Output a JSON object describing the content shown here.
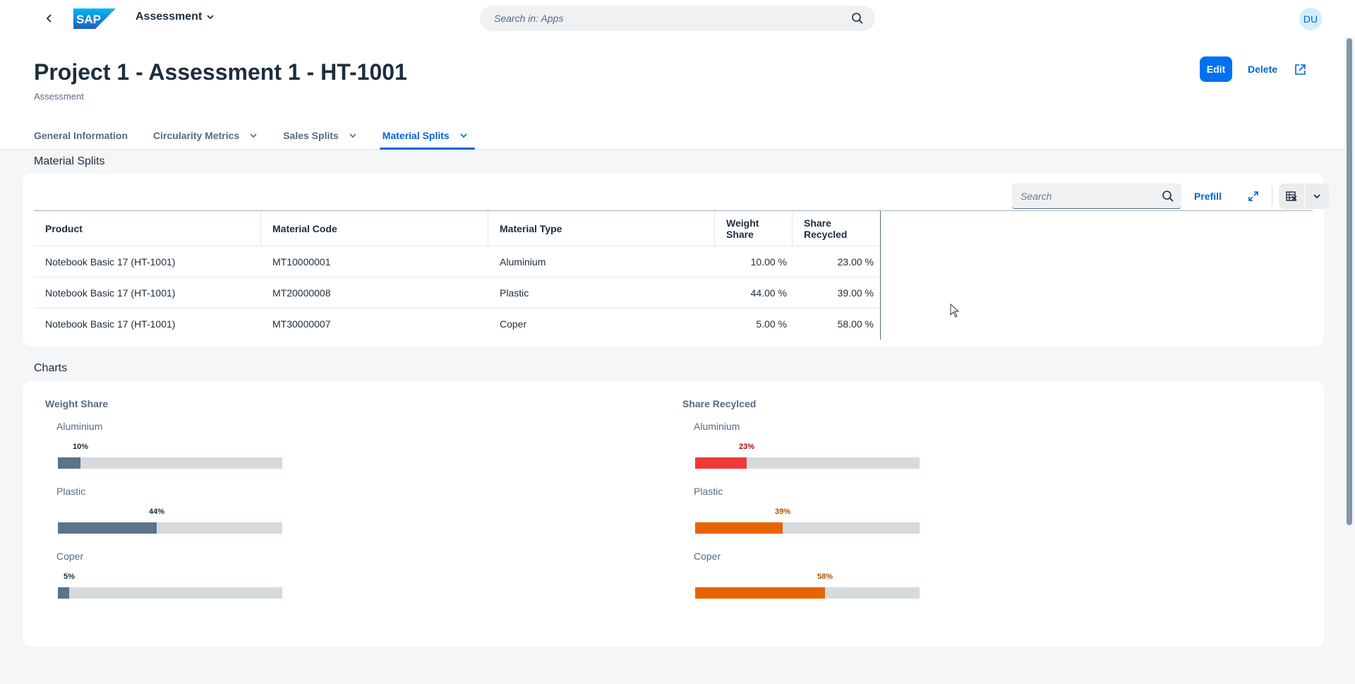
{
  "shell": {
    "app_title": "Assessment",
    "search_placeholder": "Search in: Apps",
    "avatar_initials": "DU",
    "logo_text": "SAP"
  },
  "header": {
    "title": "Project 1 - Assessment 1 - HT-1001",
    "subtitle": "Assessment",
    "edit_label": "Edit",
    "delete_label": "Delete"
  },
  "tabs": [
    {
      "label": "General Information",
      "has_menu": false,
      "active": false
    },
    {
      "label": "Circularity Metrics",
      "has_menu": true,
      "active": false
    },
    {
      "label": "Sales Splits",
      "has_menu": true,
      "active": false
    },
    {
      "label": "Material Splits",
      "has_menu": true,
      "active": true
    }
  ],
  "material_splits": {
    "section_title": "Material Splits",
    "search_placeholder": "Search",
    "prefill_label": "Prefill",
    "columns": [
      "Product",
      "Material Code",
      "Material Type",
      "Weight Share",
      "Share Recycled"
    ],
    "rows": [
      [
        "Notebook Basic 17 (HT-1001)",
        "MT10000001",
        "Aluminium",
        "10.00 %",
        "23.00 %"
      ],
      [
        "Notebook Basic 17 (HT-1001)",
        "MT20000008",
        "Plastic",
        "44.00 %",
        "39.00 %"
      ],
      [
        "Notebook Basic 17 (HT-1001)",
        "MT30000007",
        "Coper",
        "5.00 %",
        "58.00 %"
      ]
    ]
  },
  "charts_section": {
    "section_title": "Charts"
  },
  "chart_data": [
    {
      "type": "bar",
      "title": "Weight Share",
      "categories": [
        "Aluminium",
        "Plastic",
        "Coper"
      ],
      "values": [
        10,
        44,
        5
      ],
      "labels": [
        "10%",
        "44%",
        "5%"
      ],
      "colors": [
        "#5b738b",
        "#5b738b",
        "#5b738b"
      ],
      "ylim": [
        0,
        100
      ]
    },
    {
      "type": "bar",
      "title": "Share Recylced",
      "categories": [
        "Aluminium",
        "Plastic",
        "Coper"
      ],
      "values": [
        23,
        39,
        58
      ],
      "labels": [
        "23%",
        "39%",
        "58%"
      ],
      "colors": [
        "#ee3939",
        "#e76500",
        "#e76500"
      ],
      "label_colors": [
        "#aa0808",
        "#b44f00",
        "#b44f00"
      ],
      "ylim": [
        0,
        100
      ]
    }
  ],
  "colors": {
    "accent": "#0070f2",
    "link": "#0064d9",
    "track": "#d5dadd"
  }
}
